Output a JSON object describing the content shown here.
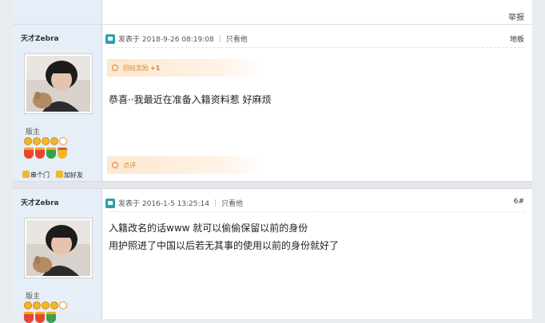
{
  "header": {
    "report_label": "举报"
  },
  "posts": [
    {
      "username": "天才Zebra",
      "role": "版主",
      "posted_on": "发表于 2018-9-26 08:19:08",
      "view_only": "只看他",
      "floor": "地板",
      "award_label": "回帖奖励",
      "award_value": "+1",
      "message": "恭喜··我最近在准备入籍资料惹 好麻烦",
      "comment_label": "点评",
      "actions": [
        "串个门",
        "加好友"
      ]
    },
    {
      "username": "天才Zebra",
      "role": "版主",
      "posted_on": "发表于 2016-1-5 13:25:14",
      "view_only": "只看他",
      "floor": "6#",
      "messages": [
        "入籍改名的话www 就可以偷偷保留以前的身份",
        "用护照进了中国以后若无其事的使用以前的身份就好了"
      ]
    }
  ],
  "colors": {
    "sidebar_bg": "#e6eef7",
    "accent_orange": "#e07b39",
    "post_icon": "#2aa0a6"
  },
  "icons": [
    "post-icon",
    "avatar-image",
    "star-icon",
    "medal-icon",
    "add-friend-icon",
    "visit-icon"
  ]
}
